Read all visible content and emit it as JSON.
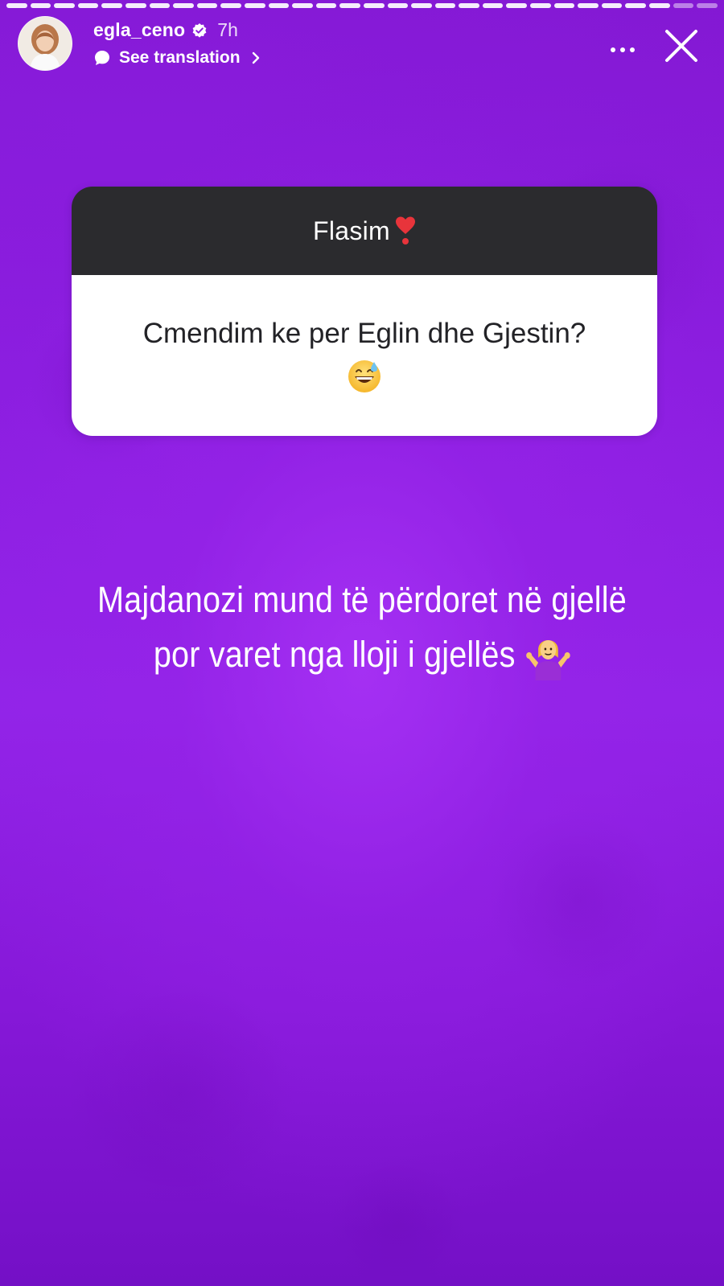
{
  "story": {
    "progress_segments": 30,
    "viewed_segments": 28,
    "background_color": "#8c1ee0"
  },
  "header": {
    "username": "egla_ceno",
    "timestamp": "7h",
    "translate_label": "See translation",
    "verified": true,
    "icons": {
      "verified": "verified-badge-icon",
      "translate": "speech-bubble-icon",
      "chevron": "chevron-right-icon",
      "more": "more-options-icon",
      "close": "close-icon"
    }
  },
  "question_sticker": {
    "title": "Flasim",
    "title_emoji": "heavy-heart-exclamation-icon",
    "question": "Cmendim ke per Eglin dhe Gjestin?",
    "question_emoji": "grinning-face-with-sweat-icon",
    "header_color": "#2b2b2e"
  },
  "answer": {
    "line1": "Majdanozi mund të përdoret në gjellë",
    "line2": "por varet nga lloji i gjellës",
    "emoji": "person-shrugging-icon"
  }
}
